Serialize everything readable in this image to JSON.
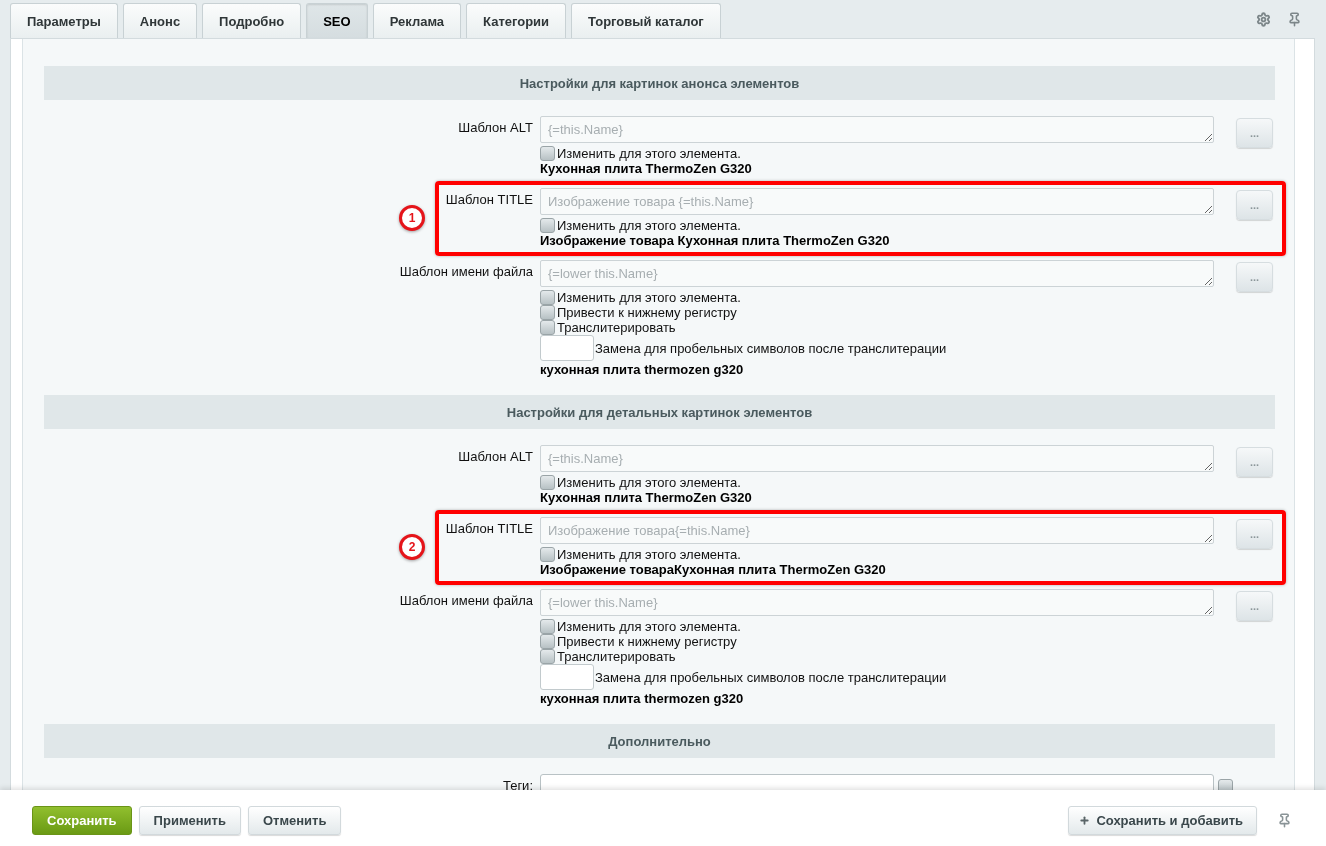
{
  "tabs": [
    {
      "label": "Параметры",
      "selected": false
    },
    {
      "label": "Анонс",
      "selected": false
    },
    {
      "label": "Подробно",
      "selected": false
    },
    {
      "label": "SEO",
      "selected": true
    },
    {
      "label": "Реклама",
      "selected": false
    },
    {
      "label": "Категории",
      "selected": false
    },
    {
      "label": "Торговый каталог",
      "selected": false
    }
  ],
  "sections": [
    {
      "title": "Настройки для картинок анонса элементов",
      "fields": [
        {
          "kind": "template",
          "label": "Шаблон ALT",
          "placeholder": "{=this.Name}",
          "button": "...",
          "options": [
            {
              "label": "Изменить для этого элемента.",
              "checked": false
            }
          ],
          "preview": "Кухонная плита ThermoZen G320"
        },
        {
          "kind": "template",
          "label": "Шаблон TITLE",
          "placeholder": "Изображение товара {=this.Name}",
          "button": "...",
          "callout": "1",
          "options": [
            {
              "label": "Изменить для этого элемента.",
              "checked": false
            }
          ],
          "preview": "Изображение товара Кухонная плита ThermoZen G320"
        },
        {
          "kind": "template",
          "label": "Шаблон имени файла",
          "placeholder": "{=lower this.Name}",
          "button": "...",
          "options": [
            {
              "label": "Изменить для этого элемента.",
              "checked": false
            },
            {
              "label": "Привести к нижнему регистру",
              "checked": false
            },
            {
              "label": "Транслитерировать",
              "checked": false
            }
          ],
          "replacement_label": "Замена для пробельных символов после транслитерации",
          "preview": "кухонная плита thermozen g320"
        }
      ]
    },
    {
      "title": "Настройки для детальных картинок элементов",
      "fields": [
        {
          "kind": "template",
          "label": "Шаблон ALT",
          "placeholder": "{=this.Name}",
          "button": "...",
          "options": [
            {
              "label": "Изменить для этого элемента.",
              "checked": false
            }
          ],
          "preview": "Кухонная плита ThermoZen G320"
        },
        {
          "kind": "template",
          "label": "Шаблон TITLE",
          "placeholder": "Изображение товара{=this.Name}",
          "button": "...",
          "callout": "2",
          "options": [
            {
              "label": "Изменить для этого элемента.",
              "checked": false
            }
          ],
          "preview": "Изображение товараКухонная плита ThermoZen G320"
        },
        {
          "kind": "template",
          "label": "Шаблон имени файла",
          "placeholder": "{=lower this.Name}",
          "button": "...",
          "options": [
            {
              "label": "Изменить для этого элемента.",
              "checked": false
            },
            {
              "label": "Привести к нижнему регистру",
              "checked": false
            },
            {
              "label": "Транслитерировать",
              "checked": false
            }
          ],
          "replacement_label": "Замена для пробельных символов после транслитерации",
          "preview": "кухонная плита thermozen g320"
        }
      ]
    },
    {
      "title": "Дополнительно",
      "fields": [
        {
          "kind": "tags",
          "label": "Теги:"
        }
      ]
    }
  ],
  "footer": {
    "buttons": [
      {
        "label": "Сохранить",
        "kind": "primary"
      },
      {
        "label": "Применить",
        "kind": "secondary"
      },
      {
        "label": "Отменить",
        "kind": "secondary"
      },
      {
        "label": "Сохранить и добавить",
        "kind": "add"
      }
    ]
  }
}
